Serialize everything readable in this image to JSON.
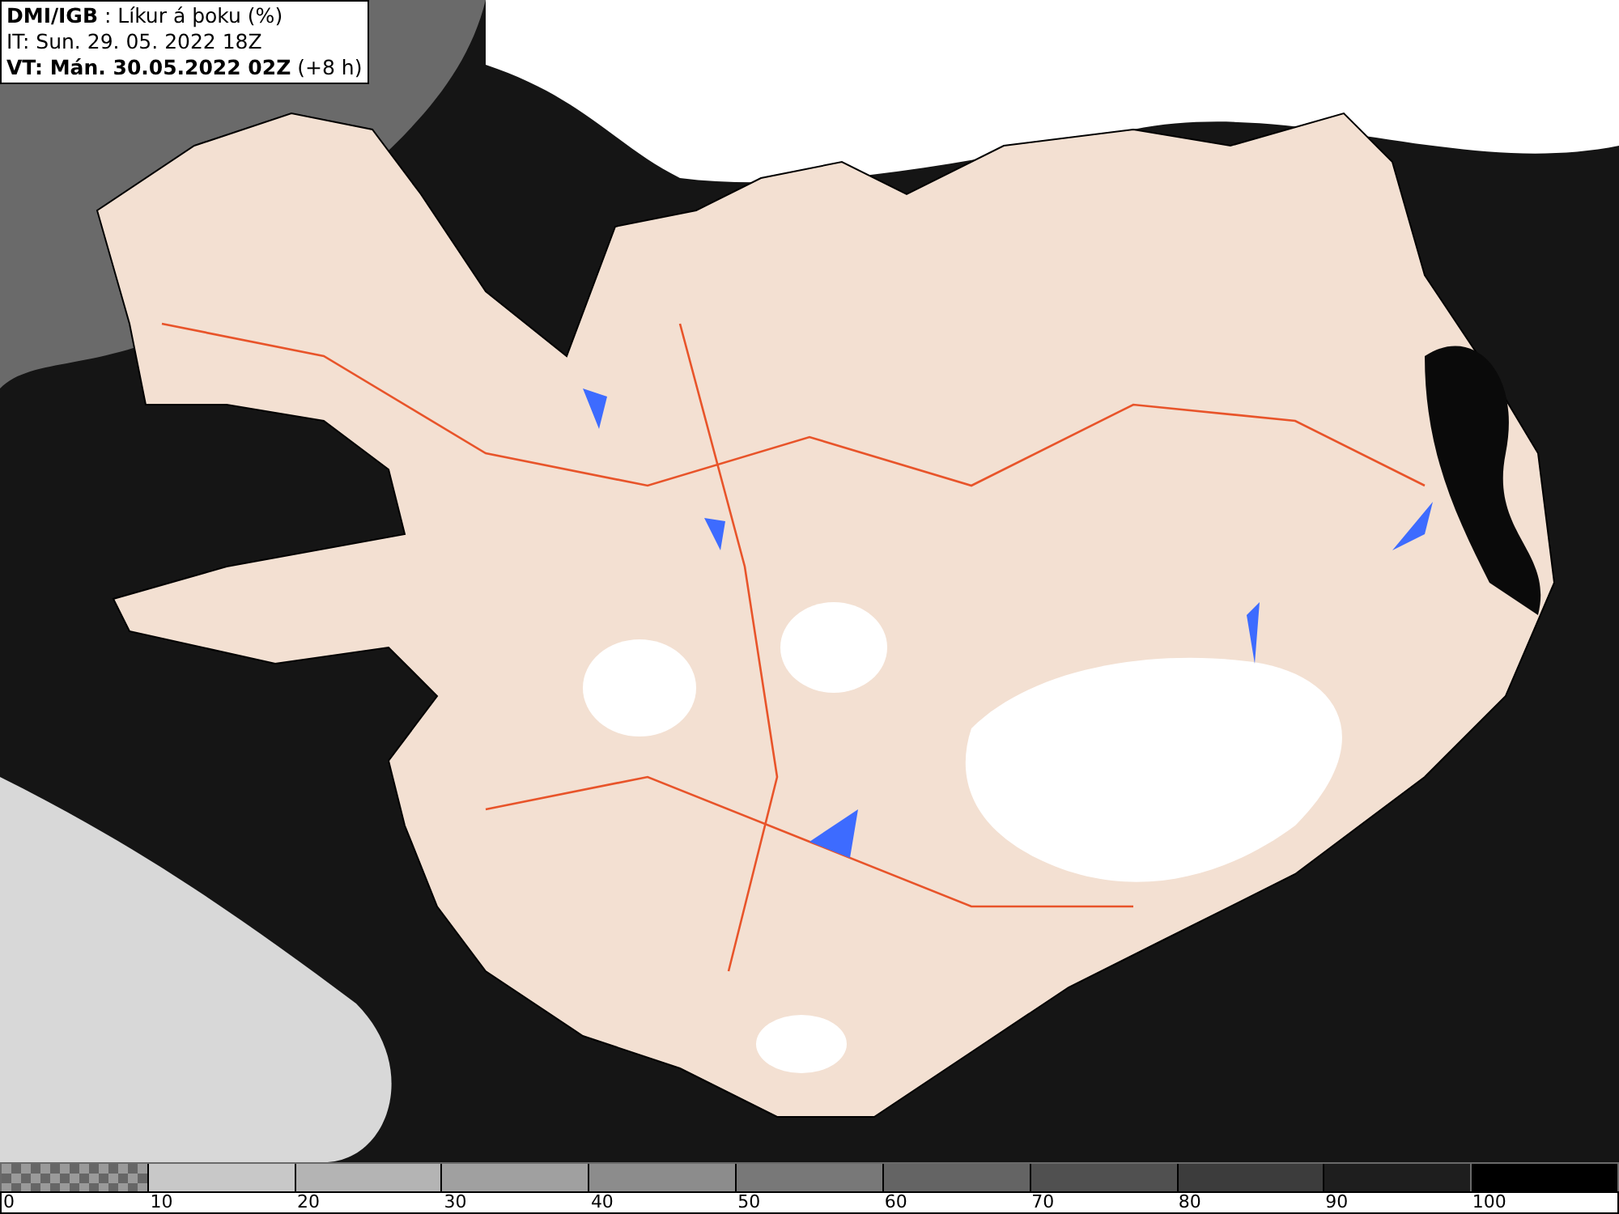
{
  "header": {
    "lines": [
      "**DMI/IGB** : Líkur á þoku (%)",
      "IT: Sun. 29. 05. 2022 18Z",
      "**VT: Mán. 30.05.2022 02Z** (+8 h)"
    ]
  },
  "legend": {
    "segments": [
      {
        "kind": "checkered"
      },
      {
        "kind": "solid",
        "color": "#c8c8c8"
      },
      {
        "kind": "solid",
        "color": "#b4b4b4"
      },
      {
        "kind": "solid",
        "color": "#a0a0a0"
      },
      {
        "kind": "solid",
        "color": "#8c8c8c"
      },
      {
        "kind": "solid",
        "color": "#787878"
      },
      {
        "kind": "solid",
        "color": "#646464"
      },
      {
        "kind": "solid",
        "color": "#505050"
      },
      {
        "kind": "solid",
        "color": "#3c3c3c"
      },
      {
        "kind": "solid",
        "color": "#1e1e1e"
      },
      {
        "kind": "solid",
        "color": "#000000"
      }
    ],
    "labels": [
      "0",
      "10",
      "20",
      "30",
      "40",
      "50",
      "60",
      "70",
      "80",
      "90",
      "100"
    ]
  }
}
